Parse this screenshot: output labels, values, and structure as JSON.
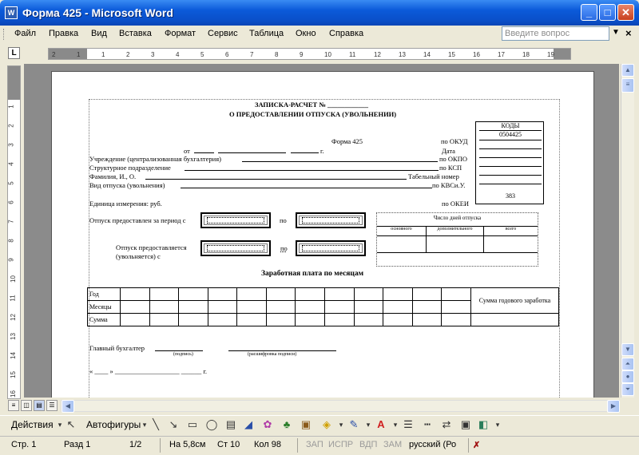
{
  "window": {
    "title": "Форма 425 - Microsoft Word",
    "icon_label": "W"
  },
  "menu": [
    "Файл",
    "Правка",
    "Вид",
    "Вставка",
    "Формат",
    "Сервис",
    "Таблица",
    "Окно",
    "Справка"
  ],
  "question_box": {
    "placeholder": "Введите вопрос"
  },
  "ruler": {
    "h_ticks": [
      "2",
      "1",
      "1",
      "2",
      "3",
      "4",
      "5",
      "6",
      "7",
      "8",
      "9",
      "10",
      "11",
      "12",
      "13",
      "14",
      "15",
      "16",
      "17",
      "18",
      "19"
    ],
    "v_ticks": [
      "1",
      "2",
      "3",
      "4",
      "5",
      "6",
      "7",
      "8",
      "9",
      "10",
      "11",
      "12",
      "13",
      "14",
      "15",
      "16"
    ]
  },
  "document": {
    "title1": "ЗАПИСКА-РАСЧЕТ № ____________",
    "title2": "О ПРЕДОСТАВЛЕНИИ ОТПУСКА (УВОЛЬНЕНИИ)",
    "kody_header": "КОДЫ",
    "form_label": "Форма 425",
    "okud_label": "по ОКУД",
    "okud_value": "0504425",
    "from_label": "от",
    "year_suffix": "г.",
    "date_label": "Дата",
    "inst_label": "Учреждение (централизованная бухгалтерия)",
    "okpo_label": "по ОКПО",
    "dept_label": "Структурное подразделение",
    "ksp_label": "по КСП",
    "name_label": "Фамилия, И., О.",
    "tab_label": "Табельный номер",
    "leave_label": "Вид отпуска (увольнения)",
    "kvsu_label": "по КВСи.У.",
    "unit_label": "Единица измерения: руб.",
    "okei_label": "по ОКЕИ",
    "okei_value": "383",
    "period_label": "Отпуск предоставлен за период с",
    "to_label": "по",
    "to_label2": "по",
    "given_label1": "Отпуск предоставляется",
    "given_label2": "(увольняется) с",
    "days_header": "Число дней отпуска",
    "days_cols": [
      "основного",
      "дополнительного",
      "всего"
    ],
    "salary_title": "Заработная плата по месяцам",
    "salary_rows": [
      "Год",
      "Месяцы",
      "Сумма"
    ],
    "annual_label": "Сумма годового заработка",
    "accountant_label": "Главный бухгалтер",
    "sign_label": "(подпись)",
    "decode_label": "(расшифровка подписи)",
    "date_bottom": "« ____ » ___________________ ______ г."
  },
  "drawbar": {
    "actions": "Действия",
    "autoshapes": "Автофигуры"
  },
  "status": {
    "page": "Стр. 1",
    "section": "Разд 1",
    "pages": "1/2",
    "at": "На 5,8см",
    "line": "Ст 10",
    "col": "Кол 98",
    "rec": "ЗАП",
    "trk": "ИСПР",
    "ext": "ВДП",
    "ovr": "ЗАМ",
    "lang": "русский (Ро"
  }
}
